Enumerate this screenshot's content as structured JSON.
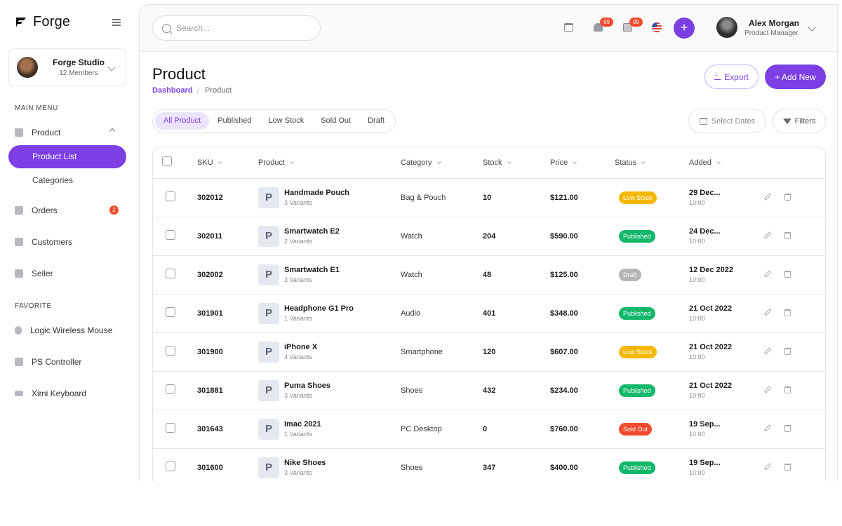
{
  "brand": {
    "name": "Forge"
  },
  "workspace": {
    "name": "Forge Studio",
    "members": "12 Members"
  },
  "sidebar": {
    "main_menu_label": "MAIN MENU",
    "product_label": "Product",
    "product_list_label": "Product List",
    "categories_label": "Categories",
    "orders_label": "Orders",
    "orders_badge": "2",
    "customers_label": "Customers",
    "seller_label": "Seller",
    "favorite_label": "FAVORITE",
    "favorites": [
      "Logic Wireless Mouse",
      "PS Controller",
      "Ximi Keyboard"
    ]
  },
  "topbar": {
    "search_placeholder": "Search...",
    "notifications_count": "99",
    "messages_count": "99",
    "user_name": "Alex Morgan",
    "user_role": "Product Manager"
  },
  "page": {
    "title": "Product",
    "breadcrumb_link": "Dashboard",
    "breadcrumb_sep": "/",
    "breadcrumb_current": "Product",
    "export_label": "Export",
    "add_new_label": "+ Add New",
    "select_dates_label": "Select Dates",
    "filters_label": "Filters"
  },
  "tabs": [
    "All Product",
    "Published",
    "Low Stock",
    "Sold Out",
    "Draft"
  ],
  "table": {
    "headers": [
      "SKU",
      "Product",
      "Category",
      "Stock",
      "Price",
      "Status",
      "Added"
    ],
    "rows": [
      {
        "sku": "302012",
        "thumb": "P",
        "name": "Handmade Pouch",
        "variants": "3 Variants",
        "category": "Bag & Pouch",
        "stock": "10",
        "price": "$121.00",
        "status": "Low Stock",
        "status_color": "#f5b800",
        "date": "29 Dec...",
        "time": "10:00"
      },
      {
        "sku": "302011",
        "thumb": "P",
        "name": "Smartwatch E2",
        "variants": "2 Variants",
        "category": "Watch",
        "stock": "204",
        "price": "$590.00",
        "status": "Published",
        "status_color": "#12b76a",
        "date": "24 Dec...",
        "time": "10:00"
      },
      {
        "sku": "302002",
        "thumb": "P",
        "name": "Smartwatch E1",
        "variants": "3 Variants",
        "category": "Watch",
        "stock": "48",
        "price": "$125.00",
        "status": "Draft",
        "status_color": "#b5b5b5",
        "date": "12 Dec 2022",
        "time": "10:00"
      },
      {
        "sku": "301901",
        "thumb": "P",
        "name": "Headphone G1 Pro",
        "variants": "1 Variants",
        "category": "Audio",
        "stock": "401",
        "price": "$348.00",
        "status": "Published",
        "status_color": "#12b76a",
        "date": "21 Oct 2022",
        "time": "10:00"
      },
      {
        "sku": "301900",
        "thumb": "P",
        "name": "iPhone X",
        "variants": "4 Variants",
        "category": "Smartphone",
        "stock": "120",
        "price": "$607.00",
        "status": "Low Stock",
        "status_color": "#f5b800",
        "date": "21 Oct 2022",
        "time": "10:00"
      },
      {
        "sku": "301881",
        "thumb": "P",
        "name": "Puma Shoes",
        "variants": "3 Variants",
        "category": "Shoes",
        "stock": "432",
        "price": "$234.00",
        "status": "Published",
        "status_color": "#12b76a",
        "date": "21 Oct 2022",
        "time": "10:00"
      },
      {
        "sku": "301643",
        "thumb": "P",
        "name": "Imac 2021",
        "variants": "1 Variants",
        "category": "PC Desktop",
        "stock": "0",
        "price": "$760.00",
        "status": "Sold Out",
        "status_color": "#f04b2d",
        "date": "19 Sep...",
        "time": "10:00"
      },
      {
        "sku": "301600",
        "thumb": "P",
        "name": "Nike Shoes",
        "variants": "3 Variants",
        "category": "Shoes",
        "stock": "347",
        "price": "$400.00",
        "status": "Published",
        "status_color": "#12b76a",
        "date": "19 Sep...",
        "time": "10:00"
      }
    ]
  },
  "colors": {
    "accent": "#7b3fe4",
    "accent_light": "#ece4fc",
    "danger": "#f04b2d"
  }
}
